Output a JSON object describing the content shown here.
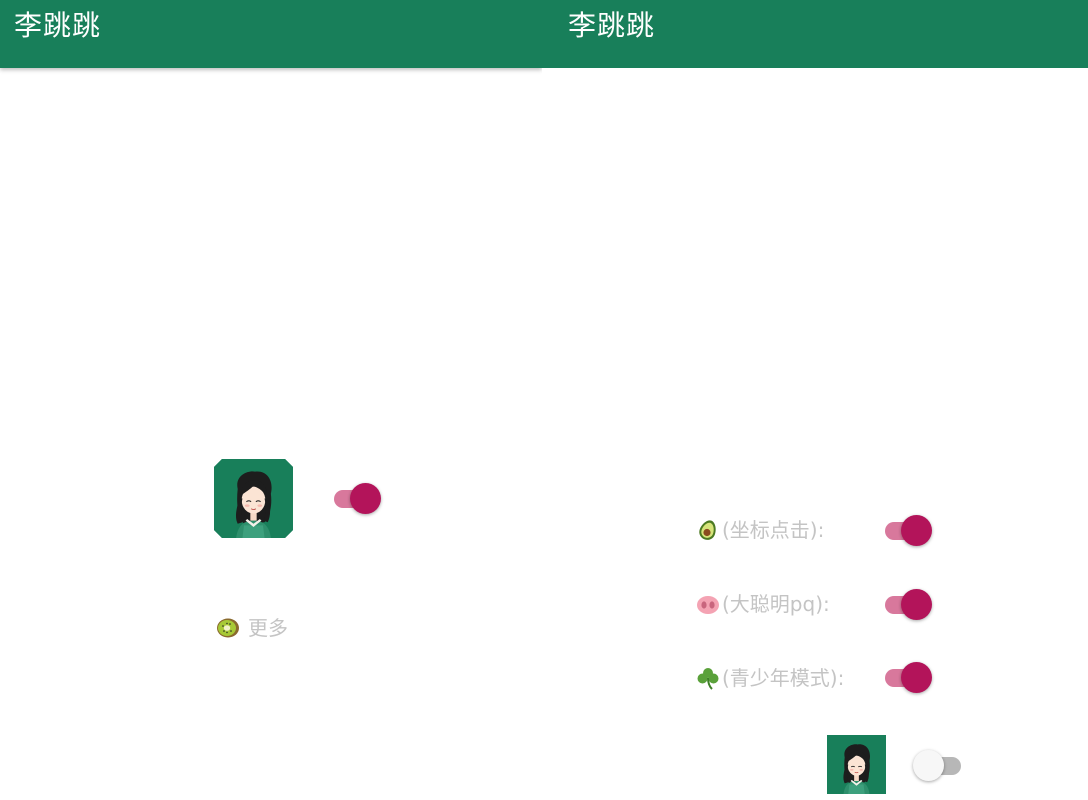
{
  "screens": [
    {
      "app_bar": {
        "title": "李跳跳"
      },
      "avatar": {
        "icon": "girl-avatar-icon"
      },
      "toggle": {
        "state": "on",
        "color": "#b3145a"
      },
      "more": {
        "icon": "kiwi-icon",
        "label": "更多"
      }
    },
    {
      "app_bar": {
        "title": "李跳跳"
      },
      "options": [
        {
          "icon": "avocado-icon",
          "label": "(坐标点击):",
          "state": "on"
        },
        {
          "icon": "pig-nose-icon",
          "label": "(大聪明pq):",
          "state": "on"
        },
        {
          "icon": "shamrock-icon",
          "label": "(青少年模式):",
          "state": "on"
        }
      ],
      "avatar": {
        "icon": "girl-avatar-icon"
      },
      "toggle": {
        "state": "off"
      }
    }
  ],
  "colors": {
    "app_bar": "#187f5a",
    "accent": "#b3145a",
    "accent_track": "#d8789c",
    "label_text": "#c4c4c4"
  }
}
